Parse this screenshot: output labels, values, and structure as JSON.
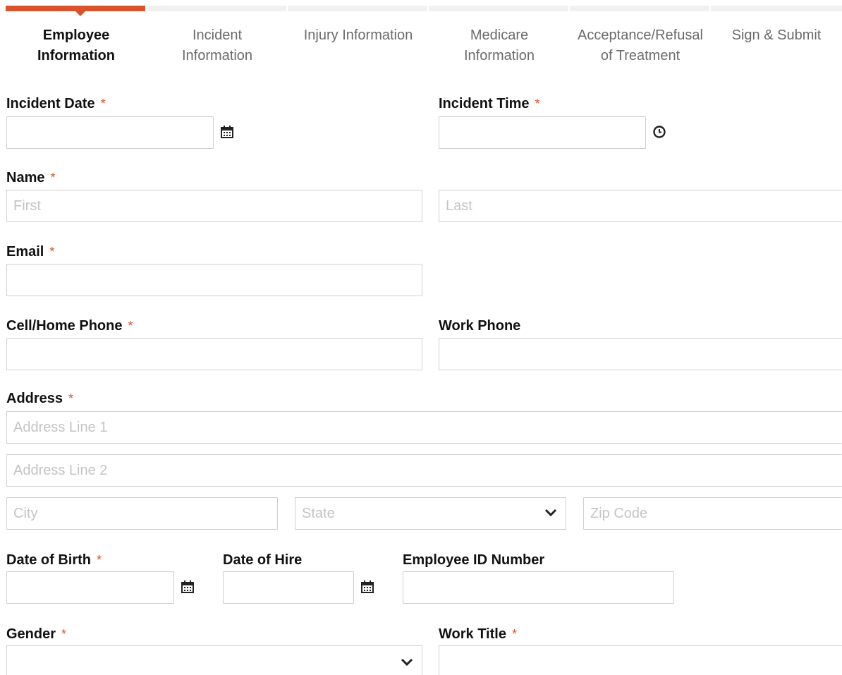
{
  "steps": [
    {
      "label": "Employee\nInformation",
      "active": true
    },
    {
      "label": "Incident\nInformation",
      "active": false
    },
    {
      "label": "Injury Information",
      "active": false
    },
    {
      "label": "Medicare\nInformation",
      "active": false
    },
    {
      "label": "Acceptance/Refusal\nof Treatment",
      "active": false
    },
    {
      "label": "Sign & Submit",
      "active": false
    }
  ],
  "required_mark": "*",
  "form": {
    "incident_date": {
      "label": "Incident Date",
      "value": "",
      "required": true
    },
    "incident_time": {
      "label": "Incident Time",
      "value": "",
      "required": true
    },
    "name": {
      "label": "Name",
      "required": true,
      "first_placeholder": "First",
      "last_placeholder": "Last"
    },
    "email": {
      "label": "Email",
      "value": "",
      "required": true
    },
    "cell_phone": {
      "label": "Cell/Home Phone",
      "value": "",
      "required": true
    },
    "work_phone": {
      "label": "Work Phone",
      "value": "",
      "required": false
    },
    "address": {
      "label": "Address",
      "required": true,
      "line1_placeholder": "Address Line 1",
      "line2_placeholder": "Address Line 2",
      "city_placeholder": "City",
      "state_placeholder": "State",
      "zip_placeholder": "Zip Code"
    },
    "date_of_birth": {
      "label": "Date of Birth",
      "value": "",
      "required": true
    },
    "date_of_hire": {
      "label": "Date of Hire",
      "value": "",
      "required": false
    },
    "employee_id": {
      "label": "Employee ID Number",
      "value": "",
      "required": false
    },
    "gender": {
      "label": "Gender",
      "selected": "",
      "required": true
    },
    "work_title": {
      "label": "Work Title",
      "value": "",
      "required": true
    }
  },
  "colors": {
    "accent": "#d9542b",
    "border": "#cfcfcf",
    "placeholder": "#c4c4c4"
  }
}
